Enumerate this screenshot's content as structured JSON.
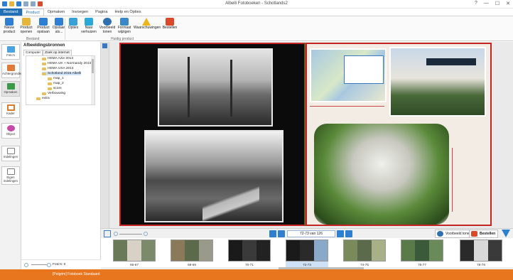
{
  "window": {
    "title": "Albelli Fotoboeken - Schotlands2",
    "controls": [
      "?",
      "—",
      "☐",
      "✕"
    ]
  },
  "ribbon_tabs": [
    {
      "label": "Bestand"
    },
    {
      "label": "Product"
    },
    {
      "label": "Opmaken"
    },
    {
      "label": "Invoegen"
    },
    {
      "label": "Pagina"
    },
    {
      "label": "Help en Opties"
    }
  ],
  "ribbon": {
    "buttons": [
      {
        "label": "Nieuw product",
        "icon": "new-product-icon",
        "color": "#2e7fd4"
      },
      {
        "label": "Product openen",
        "icon": "open-folder-icon",
        "color": "#e6b53c"
      },
      {
        "label": "Product opslaan",
        "icon": "save-icon",
        "color": "#2e7fd4"
      },
      {
        "label": "Opslaan als...",
        "icon": "save-as-icon",
        "color": "#2e7fd4"
      },
      {
        "label": "Opties",
        "icon": "options-icon",
        "color": "#3aa0d8"
      },
      {
        "label": "Naar verhuizen",
        "icon": "move-icon",
        "color": "#2aa8d8"
      },
      {
        "label": "Voorbeeld tonen",
        "icon": "preview-icon",
        "color": "#2f6fb0"
      },
      {
        "label": "Formaat wijzigen",
        "icon": "resize-icon",
        "color": "#3b88c9"
      },
      {
        "label": "Waarschuwingen",
        "icon": "warning-icon",
        "color": "#f0b31c"
      },
      {
        "label": "Bestellen",
        "icon": "cart-icon",
        "color": "#d84a2b"
      }
    ],
    "groups": [
      "Bestand",
      "Huidig product"
    ]
  },
  "left_tools": [
    {
      "label": "Foto's",
      "icon": "photos-icon",
      "color": "#4aa3e0"
    },
    {
      "label": "Achtergronden",
      "icon": "backgrounds-icon",
      "color": "#e07a3a"
    },
    {
      "label": "Opmaken",
      "icon": "layout-icon",
      "color": "#3a9a4a"
    },
    {
      "label": "Kader",
      "icon": "frame-icon",
      "color": "#d87a2a"
    },
    {
      "label": "Object",
      "icon": "object-icon",
      "color": "#c84aa8"
    },
    {
      "label": "Indelingen",
      "icon": "layouts-icon",
      "color": "#7a7a7a"
    },
    {
      "label": "Eigen indelingen",
      "icon": "custom-layouts-icon",
      "color": "#7a7a7a"
    }
  ],
  "panel": {
    "title": "Afbeeldingsbronnen",
    "tabs": [
      "Computer",
      "Zoek op internet"
    ],
    "tree": [
      {
        "label": "HEMA Azie 2013",
        "indent": 1,
        "selected": false
      },
      {
        "label": "HEMA UK + Normandy 2013",
        "indent": 1,
        "selected": false
      },
      {
        "label": "HEMA USA 2014",
        "indent": 1,
        "selected": false
      },
      {
        "label": "Schotland 2016 Albelli",
        "indent": 1,
        "selected": true
      },
      {
        "label": "map_1",
        "indent": 2,
        "selected": false
      },
      {
        "label": "map_2",
        "indent": 2,
        "selected": false
      },
      {
        "label": "score",
        "indent": 2,
        "selected": false
      },
      {
        "label": "Verbouwing",
        "indent": 1,
        "selected": false
      },
      {
        "label": "extra",
        "indent": 0,
        "selected": false
      }
    ],
    "footer": "Foto's: 0"
  },
  "navigator": {
    "page_label": "72-73 van 126",
    "preview_label": "Voorbeeld tonen",
    "order_label": "Bestellen"
  },
  "thumbnails": [
    {
      "label": "66-67",
      "selected": false,
      "colors": [
        "#6a7a58",
        "#d8d2c6",
        "#7a8a6a"
      ]
    },
    {
      "label": "68-69",
      "selected": false,
      "colors": [
        "#8a7a5a",
        "#5a6a4a",
        "#9a9a8a"
      ]
    },
    {
      "label": "70-71",
      "selected": false,
      "colors": [
        "#1a1a1a",
        "#3a3a3a",
        "#222222"
      ]
    },
    {
      "label": "72-73",
      "selected": true,
      "colors": [
        "#1a1a1a",
        "#2a2a2a",
        "#8aa8c8"
      ]
    },
    {
      "label": "74-75",
      "selected": false,
      "colors": [
        "#7a8a5a",
        "#5a6a4a",
        "#a8b088"
      ]
    },
    {
      "label": "76-77",
      "selected": false,
      "colors": [
        "#5a7a4a",
        "#3a5a3a",
        "#6a8a5a"
      ]
    },
    {
      "label": "78-79",
      "selected": false,
      "colors": [
        "#2a2a2a",
        "#d8d8d8",
        "#3a3a3a"
      ]
    }
  ],
  "status": {
    "text": "[Pelgrim] Fotoboek Standaard"
  },
  "colors": {
    "ribbon_file": "#1f6fb7",
    "page_border": "#c42424",
    "fold": "#2b8a2b",
    "status_bar": "#e8761f"
  }
}
